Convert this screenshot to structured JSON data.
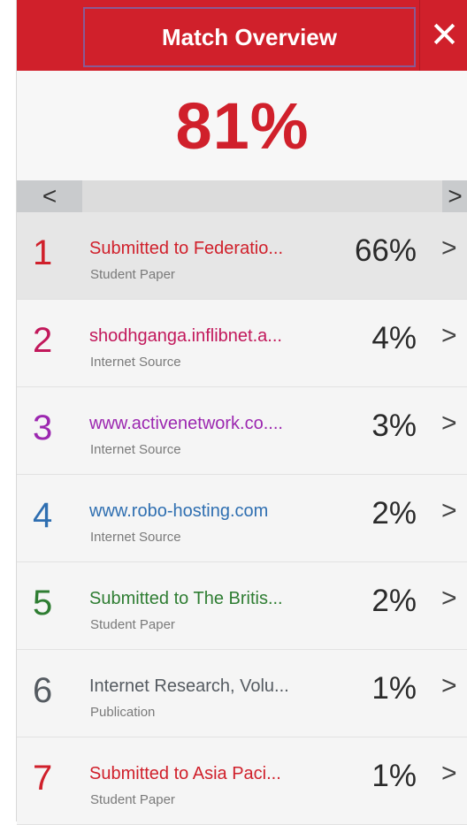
{
  "header": {
    "title": "Match Overview",
    "close_glyph": "✕",
    "color": "#d0202b"
  },
  "overall": {
    "percent": "81%"
  },
  "nav": {
    "prev_glyph": "<",
    "next_glyph": ">"
  },
  "matches": [
    {
      "rank": "1",
      "title": "Submitted to Federatio...",
      "type": "Student Paper",
      "percent": "66%",
      "color": "#d0202b",
      "selected": true
    },
    {
      "rank": "2",
      "title": "shodhganga.inflibnet.a...",
      "type": "Internet Source",
      "percent": "4%",
      "color": "#c2185b",
      "selected": false
    },
    {
      "rank": "3",
      "title": "www.activenetwork.co....",
      "type": "Internet Source",
      "percent": "3%",
      "color": "#9c27b0",
      "selected": false
    },
    {
      "rank": "4",
      "title": "www.robo-hosting.com",
      "type": "Internet Source",
      "percent": "2%",
      "color": "#2f6fb1",
      "selected": false
    },
    {
      "rank": "5",
      "title": "Submitted to The Britis...",
      "type": "Student Paper",
      "percent": "2%",
      "color": "#2e7d32",
      "selected": false
    },
    {
      "rank": "6",
      "title": "Internet Research, Volu...",
      "type": "Publication",
      "percent": "1%",
      "color": "#555b61",
      "selected": false
    },
    {
      "rank": "7",
      "title": "Submitted to Asia Paci...",
      "type": "Student Paper",
      "percent": "1%",
      "color": "#d0202b",
      "selected": false
    }
  ],
  "row_chevron": ">"
}
